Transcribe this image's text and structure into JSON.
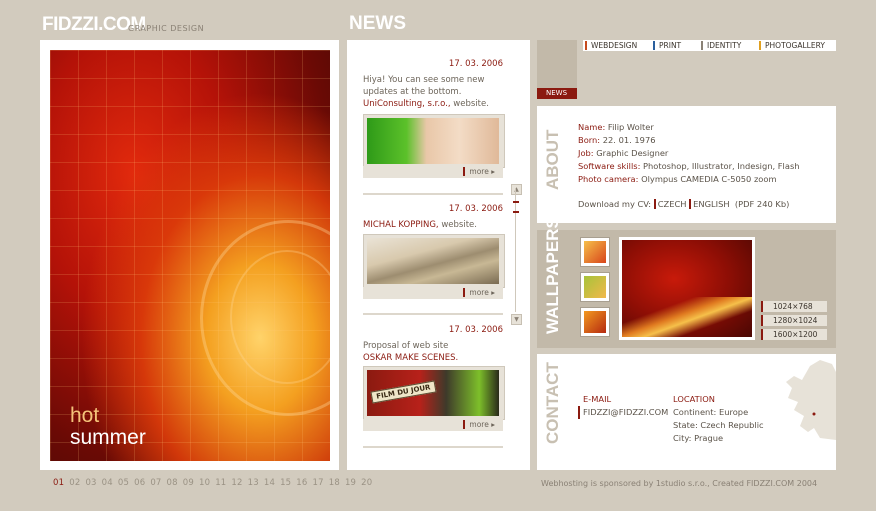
{
  "header": {
    "brand": "FIDZZI.COM",
    "brand_sub": "GRAPHIC DESIGN",
    "news_title": "NEWS"
  },
  "artwork": {
    "line1": "hot",
    "line2": "summer"
  },
  "news": [
    {
      "date": "17. 03. 2006",
      "text": "Hiya! You can see some new updates at the bottom.",
      "link": "UniConsulting, s.r.o.,",
      "suffix": " website.",
      "more": "more"
    },
    {
      "date": "17. 03. 2006",
      "text": "",
      "link": "MICHAL KOPPING,",
      "suffix": " website.",
      "more": "more"
    },
    {
      "date": "17. 03. 2006",
      "text": "Proposal of web site",
      "link": "OSKAR MAKE SCENES.",
      "suffix": "",
      "more": "more",
      "badge": "FILM DU JOUR"
    }
  ],
  "scroll": {
    "up": "▲",
    "down": "▼"
  },
  "menu": [
    {
      "label": "WEBDESIGN",
      "color": "#c64b1e"
    },
    {
      "label": "PRINT",
      "color": "#2a5f9e"
    },
    {
      "label": "IDENTITY",
      "color": "#8a8175"
    },
    {
      "label": "PHOTOGALLERY",
      "color": "#e0a020"
    }
  ],
  "news_tab": "NEWS",
  "about": {
    "label": "ABOUT",
    "rows": [
      {
        "k": "Name:",
        "v": " Filip Wolter"
      },
      {
        "k": "Born:",
        "v": " 22. 01. 1976"
      },
      {
        "k": "Job:",
        "v": " Graphic Designer"
      },
      {
        "k": "Software skills:",
        "v": " Photoshop, Illustrator, Indesign, Flash"
      },
      {
        "k": "Photo camera:",
        "v": " Olympus CAMEDIA C-5050 zoom"
      }
    ],
    "cv_prefix": "Download my CV:",
    "cv_czech": "CZECH",
    "cv_english": "ENGLISH",
    "cv_suffix": "(PDF 240 Kb)"
  },
  "wallpapers": {
    "label": "WALLPAPERS",
    "resolutions": [
      "1024×768",
      "1280×1024",
      "1600×1200"
    ]
  },
  "contact": {
    "label": "CONTACT",
    "email_heading": "E-MAIL",
    "email": "FIDZZI@FIDZZI.COM",
    "location_heading": "LOCATION",
    "continent": "Continent: Europe",
    "state": "State: Czech Republic",
    "city": "City: Prague"
  },
  "pagination": {
    "pages": [
      "01",
      "02",
      "03",
      "04",
      "05",
      "06",
      "07",
      "08",
      "09",
      "10",
      "11",
      "12",
      "13",
      "14",
      "15",
      "16",
      "17",
      "18",
      "19",
      "20"
    ],
    "current": "01"
  },
  "footer": "Webhosting is sponsored by 1studio s.r.o., Created FIDZZI.COM 2004",
  "colors": {
    "accent": "#8b1a10",
    "background": "#d2cbbe",
    "panel": "#ffffff",
    "muted_panel": "#c2b9a9"
  }
}
